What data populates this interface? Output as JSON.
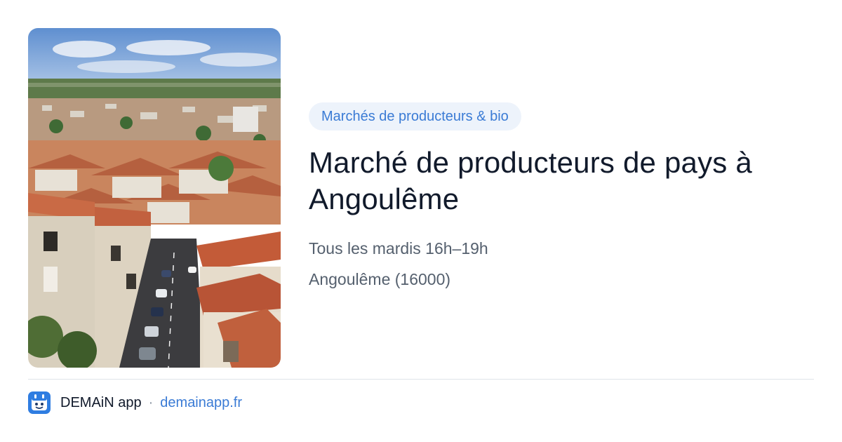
{
  "badge": {
    "label": "Marchés de producteurs & bio"
  },
  "event": {
    "title": "Marché de producteurs de pays à Angoulême",
    "schedule": "Tous les mardis 16h–19h",
    "location": "Angoulême (16000)"
  },
  "footer": {
    "app_name": "DEMAiN app",
    "separator": "·",
    "domain": "demainapp.fr"
  },
  "image": {
    "subject": "rooftops-cityscape-photo"
  },
  "colors": {
    "accent": "#3a7bd5",
    "badge_bg": "#edf3fb",
    "title": "#111a2b",
    "meta": "#55606e",
    "divider": "#dfe3e8"
  }
}
